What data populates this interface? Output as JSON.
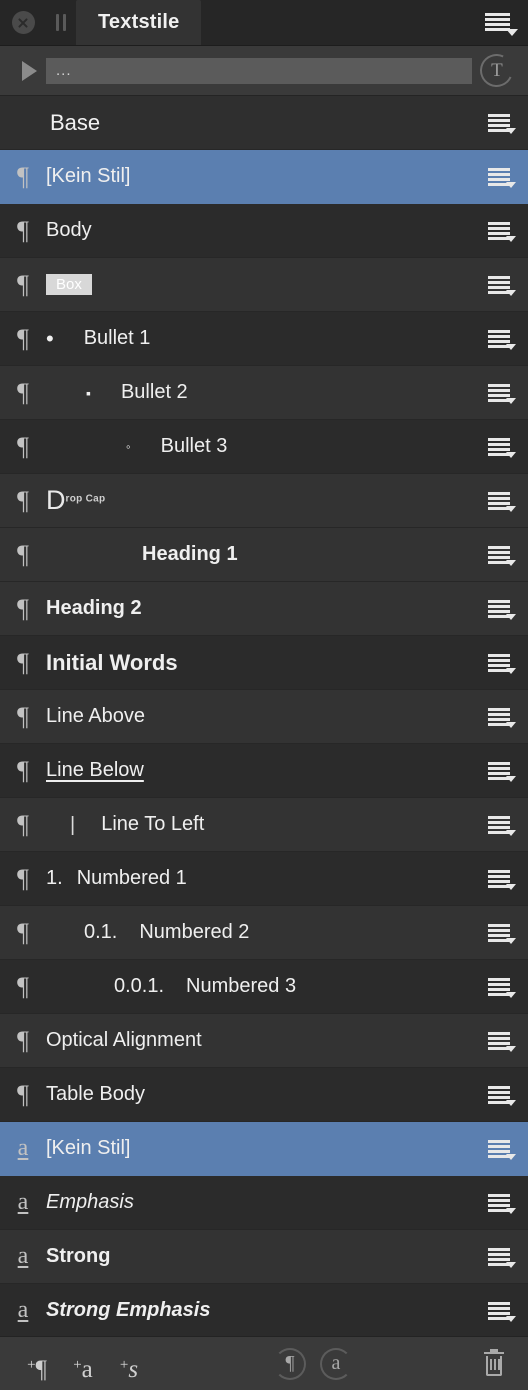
{
  "window": {
    "close_icon": "close-icon",
    "drag_handle_icon": "drag-handle-icon",
    "tab_label": "Textstile",
    "panel_menu_icon": "hamburger-menu-icon"
  },
  "search": {
    "disclosure_icon": "disclosure-triangle-icon",
    "value": "...",
    "placeholder": "...",
    "text_tool_icon": "text-tool-icon",
    "text_tool_label": "T"
  },
  "colors": {
    "selection": "#5b7fb0",
    "panel_bg": "#2b2b2b",
    "row_alt": "#333333",
    "toolbar_bg": "#3a3a3a",
    "text": "#efefef"
  },
  "list": {
    "row_menu_icon": "row-options-menu-icon",
    "para_icon": "paragraph-style-icon",
    "char_icon": "character-style-icon",
    "rows": [
      {
        "kind": "group",
        "label": "Base",
        "icon": "",
        "style": "lb-base",
        "indent": 0,
        "marker": "",
        "selected": false,
        "alt": false
      },
      {
        "kind": "paragraph",
        "label": "[Kein Stil]",
        "icon": "¶",
        "style": "lb-plain",
        "indent": 0,
        "marker": "",
        "selected": true,
        "alt": false
      },
      {
        "kind": "paragraph",
        "label": "Body",
        "icon": "¶",
        "style": "lb-plain",
        "indent": 0,
        "marker": "",
        "selected": false,
        "alt": false
      },
      {
        "kind": "paragraph",
        "label": "Box",
        "icon": "¶",
        "style": "lb-box",
        "indent": 0,
        "marker": "",
        "selected": false,
        "alt": true
      },
      {
        "kind": "paragraph",
        "label": "Bullet 1",
        "icon": "¶",
        "style": "lb-plain",
        "indent": 0,
        "marker": "•",
        "marker_class": "mk-dot",
        "gap": 30,
        "selected": false,
        "alt": false
      },
      {
        "kind": "paragraph",
        "label": "Bullet 2",
        "icon": "¶",
        "style": "lb-plain",
        "indent": 40,
        "marker": "▪",
        "marker_class": "mk-square",
        "gap": 30,
        "selected": false,
        "alt": true
      },
      {
        "kind": "paragraph",
        "label": "Bullet 3",
        "icon": "¶",
        "style": "lb-plain",
        "indent": 80,
        "marker": "◦",
        "marker_class": "mk-circ",
        "gap": 30,
        "selected": false,
        "alt": false
      },
      {
        "kind": "paragraph",
        "label": "Drop Cap",
        "icon": "¶",
        "style": "lb-dropcap",
        "indent": 0,
        "marker": "",
        "selected": false,
        "alt": true
      },
      {
        "kind": "paragraph",
        "label": "Heading 1",
        "icon": "¶",
        "style": "lb-bold",
        "indent": 96,
        "marker": "",
        "selected": false,
        "alt": true
      },
      {
        "kind": "paragraph",
        "label": "Heading 2",
        "icon": "¶",
        "style": "lb-bold",
        "indent": 0,
        "marker": "",
        "selected": false,
        "alt": true
      },
      {
        "kind": "paragraph",
        "label": "Initial Words",
        "icon": "¶",
        "style": "lb-big",
        "indent": 0,
        "marker": "",
        "selected": false,
        "alt": false
      },
      {
        "kind": "paragraph",
        "label": "Line Above",
        "icon": "¶",
        "style": "lb-overline",
        "indent": 0,
        "marker": "",
        "selected": false,
        "alt": true
      },
      {
        "kind": "paragraph",
        "label": "Line Below",
        "icon": "¶",
        "style": "lb-underline",
        "indent": 0,
        "marker": "",
        "selected": false,
        "alt": false
      },
      {
        "kind": "paragraph",
        "label": "Line To Left",
        "icon": "¶",
        "style": "lb-plain",
        "indent": 24,
        "marker": "|",
        "marker_class": "mk-bar",
        "gap": 26,
        "selected": false,
        "alt": true
      },
      {
        "kind": "paragraph",
        "label": "Numbered 1",
        "icon": "¶",
        "style": "lb-plain",
        "indent": 0,
        "marker": "1.",
        "marker_class": "mk-num",
        "gap": 14,
        "selected": false,
        "alt": false
      },
      {
        "kind": "paragraph",
        "label": "Numbered 2",
        "icon": "¶",
        "style": "lb-plain",
        "indent": 38,
        "marker": "0.1.",
        "marker_class": "mk-num",
        "gap": 22,
        "selected": false,
        "alt": true
      },
      {
        "kind": "paragraph",
        "label": "Numbered 3",
        "icon": "¶",
        "style": "lb-plain",
        "indent": 68,
        "marker": "0.0.1.",
        "marker_class": "mk-num",
        "gap": 22,
        "selected": false,
        "alt": false
      },
      {
        "kind": "paragraph",
        "label": "Optical Alignment",
        "icon": "¶",
        "style": "lb-plain",
        "indent": 0,
        "marker": "",
        "selected": false,
        "alt": true
      },
      {
        "kind": "paragraph",
        "label": "Table Body",
        "icon": "¶",
        "style": "lb-plain",
        "indent": 0,
        "marker": "",
        "selected": false,
        "alt": false
      },
      {
        "kind": "character",
        "label": "[Kein Stil]",
        "icon": "a",
        "style": "lb-plain",
        "indent": 0,
        "marker": "",
        "selected": true,
        "alt": false
      },
      {
        "kind": "character",
        "label": "Emphasis",
        "icon": "a",
        "style": "lb-italic",
        "indent": 0,
        "marker": "",
        "selected": false,
        "alt": false
      },
      {
        "kind": "character",
        "label": "Strong",
        "icon": "a",
        "style": "lb-bold",
        "indent": 0,
        "marker": "",
        "selected": false,
        "alt": true
      },
      {
        "kind": "character",
        "label": "Strong Emphasis",
        "icon": "a",
        "style": "lb-bolditalic",
        "indent": 0,
        "marker": "",
        "selected": false,
        "alt": false
      }
    ],
    "dropcap": {
      "first": "D",
      "rest": "rop Cap"
    }
  },
  "toolbar": {
    "new_paragraph_style": {
      "name": "new-paragraph-style-button",
      "plus": "+",
      "glyph": "¶"
    },
    "new_character_style": {
      "name": "new-character-style-button",
      "plus": "+",
      "glyph": "a"
    },
    "new_set_style": {
      "name": "new-style-set-button",
      "plus": "+",
      "glyph": "s"
    },
    "filter_paragraph": {
      "name": "filter-paragraph-styles-button",
      "glyph": "¶"
    },
    "filter_character": {
      "name": "filter-character-styles-button",
      "glyph": "a"
    },
    "delete": {
      "name": "delete-style-button",
      "icon": "trash-icon"
    }
  }
}
